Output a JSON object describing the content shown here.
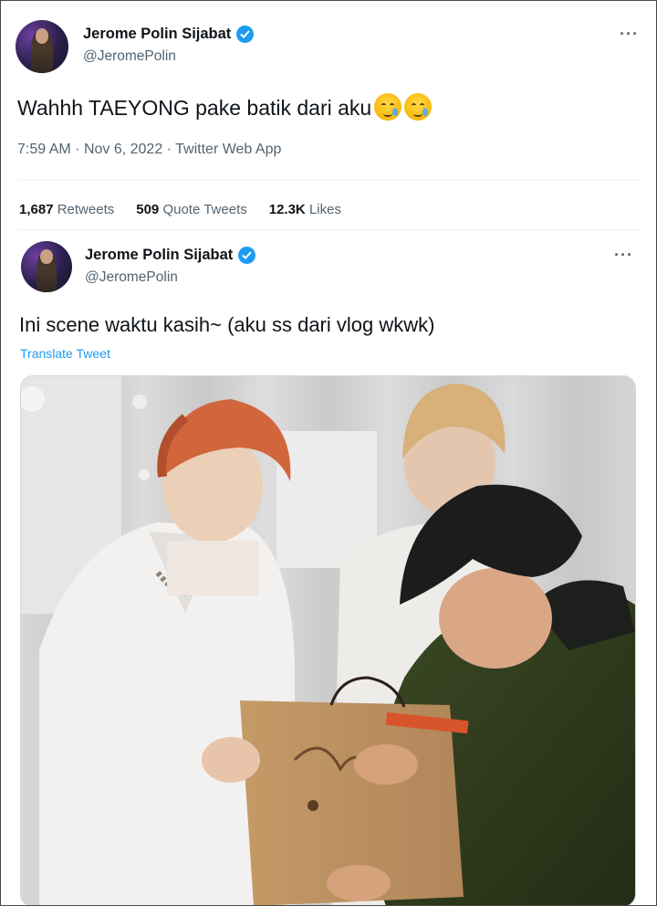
{
  "tweet": {
    "author_name": "Jerome Polin Sijabat",
    "author_handle": "@JeromePolin",
    "text": "Wahhh TAEYONG pake batik dari aku",
    "time": "7:59 AM",
    "date": "Nov 6, 2022",
    "source": "Twitter Web App",
    "stats": {
      "retweets_count": "1,687",
      "retweets_label": "Retweets",
      "quotes_count": "509",
      "quotes_label": "Quote Tweets",
      "likes_count": "12.3K",
      "likes_label": "Likes"
    }
  },
  "reply": {
    "author_name": "Jerome Polin Sijabat",
    "author_handle": "@JeromePolin",
    "text": "Ini scene waktu kasih~ (aku ss dari vlog wkwk)",
    "translate_label": "Translate Tweet"
  },
  "icons": {
    "verified": "verified-badge-icon",
    "more": "more-icon",
    "emoji": "crying-face-emoji"
  },
  "colors": {
    "accent": "#1d9bf0",
    "secondary_text": "#536471",
    "primary_text": "#0f1419"
  }
}
